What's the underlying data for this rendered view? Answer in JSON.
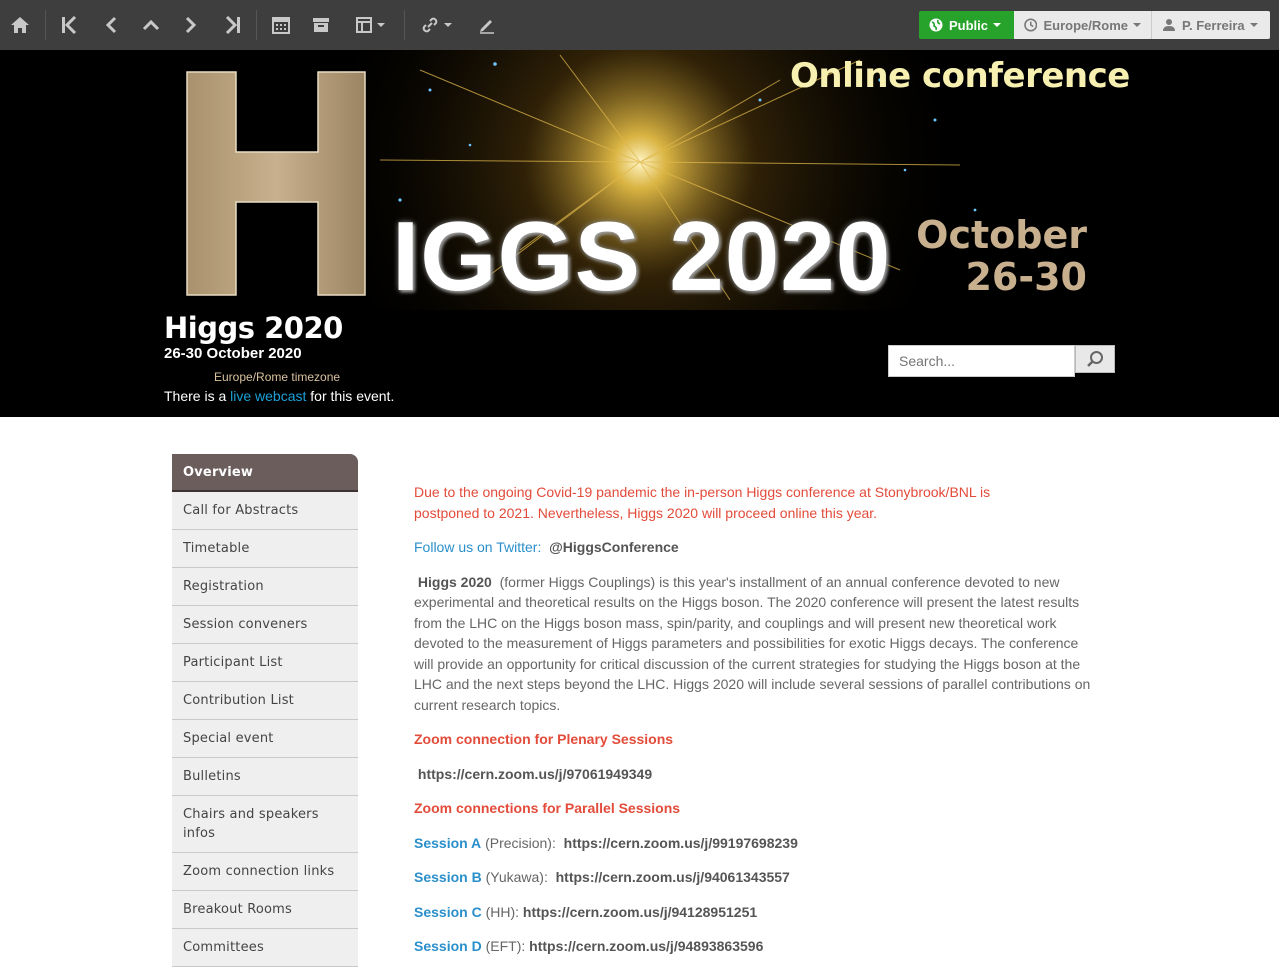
{
  "toolbar": {
    "public_label": "Public",
    "timezone_label": "Europe/Rome",
    "user_label": "P. Ferreira"
  },
  "banner": {
    "online": "Online conference",
    "iggs": "IGGS 2020",
    "month": "October",
    "days": "26-30"
  },
  "event": {
    "title": "Higgs 2020",
    "dates": "26-30 October 2020",
    "timezone": "Europe/Rome timezone",
    "webcast_prefix": "There is a",
    "webcast_link": "live webcast",
    "webcast_suffix": "for this event."
  },
  "search": {
    "placeholder": "Search..."
  },
  "menu": [
    "Overview",
    "Call for Abstracts",
    "Timetable",
    "Registration",
    "Session conveners",
    "Participant List",
    "Contribution List",
    "Special event",
    "Bulletins",
    "Chairs and speakers infos",
    "Zoom connection links",
    "Breakout Rooms",
    "Committees"
  ],
  "content": {
    "covid": "Due to the ongoing Covid-19 pandemic the in-person Higgs conference at Stonybrook/BNL is postponed to 2021. Nevertheless, Higgs 2020 will proceed online this year.",
    "twitter_label": "Follow us on Twitter:",
    "twitter_handle": "@HiggsConference",
    "intro_bold": "Higgs 2020",
    "intro": "(former Higgs Couplings) is this year's installment of an annual conference devoted to new experimental and theoretical results on the Higgs boson. The 2020 conference will present the latest results from the LHC on the Higgs boson mass, spin/parity, and couplings and will present new theoretical work devoted to the measurement of Higgs parameters and possibilities for exotic Higgs decays. The conference will provide an opportunity for critical discussion of the current strategies for studying the Higgs boson at the LHC and the next steps beyond the LHC. Higgs 2020 will include several sessions of parallel contributions on current research topics.",
    "plenary_heading": "Zoom connection for Plenary Sessions",
    "plenary_url": "https://cern.zoom.us/j/97061949349",
    "parallel_heading": "Zoom connections for Parallel Sessions",
    "sessions": [
      {
        "name": "Session A",
        "topic": "(Precision):",
        "url": "https://cern.zoom.us/j/99197698239"
      },
      {
        "name": "Session B",
        "topic": "(Yukawa):",
        "url": "https://cern.zoom.us/j/94061343557"
      },
      {
        "name": "Session C",
        "topic": "(HH):",
        "url": "https://cern.zoom.us/j/94128951251"
      },
      {
        "name": "Session D",
        "topic": "(EFT):",
        "url": "https://cern.zoom.us/j/94893863596"
      }
    ]
  },
  "colors": {
    "toolbar_bg": "#3e3e3e",
    "public_green": "#27a32b",
    "link_blue": "#2a8fcb",
    "alert_red": "#e34b3a",
    "menu_active": "#6a5d5c"
  }
}
